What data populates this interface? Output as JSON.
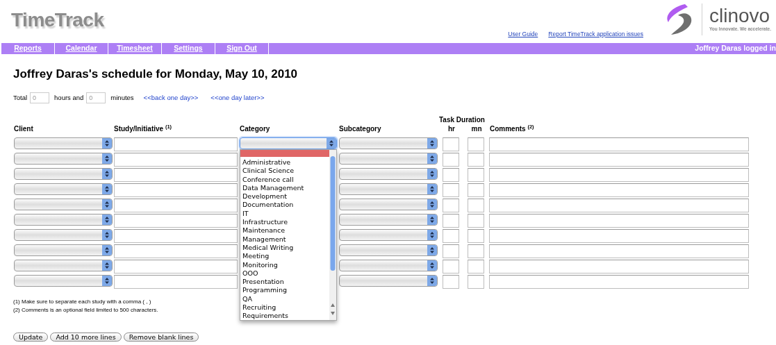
{
  "header": {
    "app_title": "TimeTrack",
    "links": [
      "User Guide",
      "Report TimeTrack application issues"
    ],
    "logo": {
      "name": "clinovo",
      "tagline": "You Innovate. We accelerate."
    }
  },
  "nav": {
    "items": [
      "Reports",
      "Calendar",
      "Timesheet",
      "Settings",
      "Sign Out"
    ],
    "user_status": "Joffrey Daras logged in"
  },
  "page_title": "Joffrey Daras's schedule for Monday, May 10, 2010",
  "total": {
    "label": "Total",
    "hours_value": "0",
    "hours_label": "hours and",
    "minutes_value": "0",
    "minutes_label": "minutes",
    "back_link": "<<back one day>>",
    "forward_link": "<<one day later>>"
  },
  "table": {
    "group_heading": "Task Duration",
    "columns": [
      "Client",
      "Study/Initiative $^{(1)}$",
      "Category",
      "Subcategory",
      "hr",
      "mn",
      "Comments $^{(2)}$"
    ],
    "rows": [
      {
        "kind": "entry"
      },
      {
        "kind": "entry"
      },
      {
        "kind": "entry"
      },
      {
        "kind": "entry"
      },
      {
        "kind": "entry"
      },
      {
        "kind": "entry"
      },
      {
        "kind": "entry"
      },
      {
        "kind": "entry"
      },
      {
        "kind": "entry"
      },
      {
        "kind": "entry"
      }
    ]
  },
  "category_menu": {
    "open": true,
    "empty_option_highlighted": true,
    "options": [
      "Administrative",
      "Clinical Science",
      "Conference call",
      "Data Management",
      "Development",
      "Documentation",
      "IT",
      "Infrastructure",
      "Maintenance",
      "Management",
      "Medical Writing",
      "Meeting",
      "Monitoring",
      "OOO",
      "Presentation",
      "Programming",
      "QA",
      "Recruiting",
      "Requirements"
    ]
  },
  "footnotes": [
    "(1) Make sure to separate each study with a comma ( , )",
    "(2) Comments is an optional field limited to 500 characters."
  ],
  "buttons": [
    "Update",
    "Add 10 more lines",
    "Remove blank lines"
  ]
}
